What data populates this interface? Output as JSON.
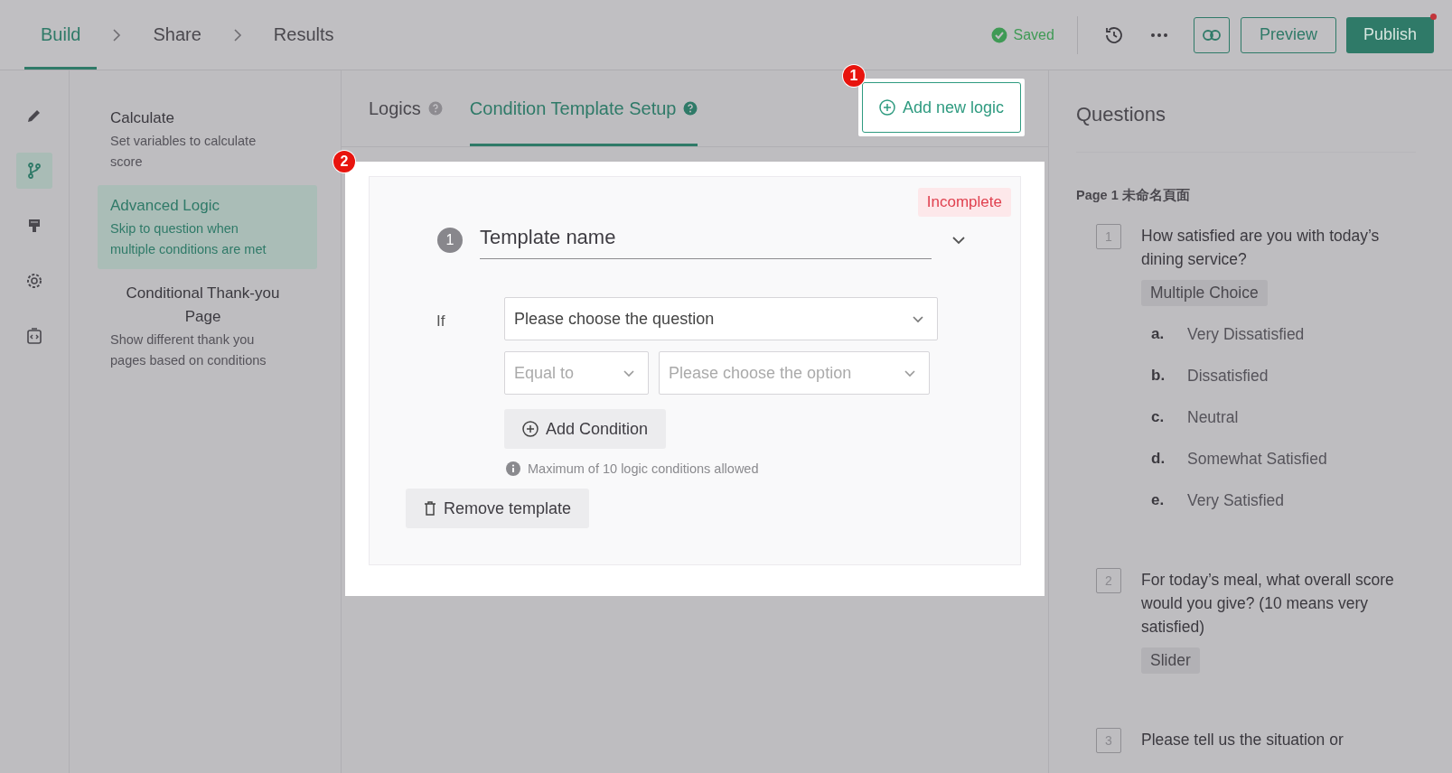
{
  "nav": {
    "steps": [
      {
        "label": "Build",
        "selected": true
      },
      {
        "label": "Share",
        "selected": false
      },
      {
        "label": "Results",
        "selected": false
      }
    ],
    "saved": "Saved",
    "preview": "Preview",
    "publish": "Publish"
  },
  "rail": [
    {
      "kind": "edit",
      "selected": false
    },
    {
      "kind": "branch",
      "selected": true
    },
    {
      "kind": "paint",
      "selected": false
    },
    {
      "kind": "settings",
      "selected": false
    },
    {
      "kind": "code",
      "selected": false
    }
  ],
  "menu": [
    {
      "title": "Calculate",
      "description": "Set variables to calculate score",
      "selected": false,
      "centered": false
    },
    {
      "title": "Advanced Logic",
      "description": "Skip to question when multiple conditions are met",
      "selected": true,
      "centered": false
    },
    {
      "title": "Conditional Thank-you Page",
      "description": "Show different thank you pages based on conditions",
      "selected": false,
      "centered": true
    }
  ],
  "tabs": [
    {
      "label": "Logics",
      "selected": false
    },
    {
      "label": "Condition Template Setup",
      "selected": true
    }
  ],
  "add_logic": "Add new logic",
  "callouts": [
    "1",
    "2"
  ],
  "template": {
    "status": "Incomplete",
    "number": "1",
    "name": "Template name",
    "if_label": "If",
    "question_select": "Please choose the question",
    "operator": "Equal to",
    "option_select": "Please choose the option",
    "add_condition": "Add Condition",
    "note": "Maximum of 10 logic conditions allowed",
    "remove": "Remove template"
  },
  "questions": {
    "title": "Questions",
    "page": "Page 1 未命名頁面",
    "items": [
      {
        "number": "1",
        "text": "How satisfied are you with today’s dining service?",
        "type": "Multiple Choice",
        "options": [
          {
            "letter": "a.",
            "text": "Very Dissatisfied"
          },
          {
            "letter": "b.",
            "text": "Dissatisfied"
          },
          {
            "letter": "c.",
            "text": "Neutral"
          },
          {
            "letter": "d.",
            "text": "Somewhat Satisfied"
          },
          {
            "letter": "e.",
            "text": "Very Satisfied"
          }
        ]
      },
      {
        "number": "2",
        "text": "For today’s meal, what overall score would you give? (10 means very satisfied)",
        "type": "Slider"
      },
      {
        "number": "3",
        "text": "Please tell us the situation or"
      }
    ]
  }
}
